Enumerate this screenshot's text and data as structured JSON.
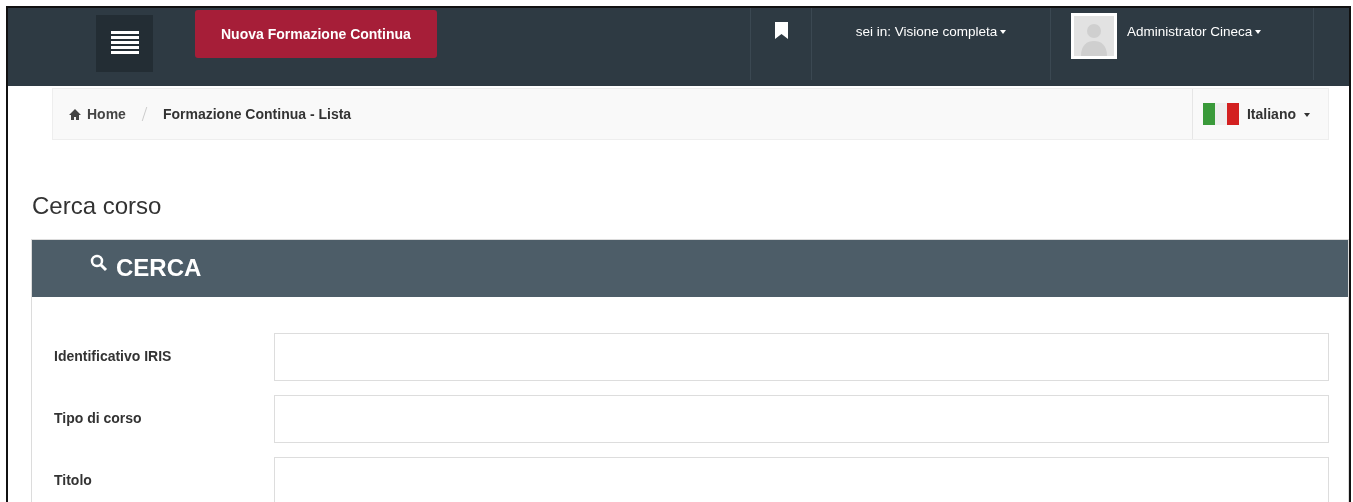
{
  "navbar": {
    "new_button": "Nuova Formazione Continua",
    "context": "sei in: Visione completa",
    "user": "Administrator Cineca"
  },
  "breadcrumb": [
    {
      "label": "Home",
      "selected": false
    },
    {
      "label": "Formazione Continua - Lista",
      "selected": true
    }
  ],
  "language": "Italiano",
  "page_title": "Cerca corso",
  "panel": {
    "title": "CERCA",
    "fields": [
      {
        "label": "Identificativo IRIS"
      },
      {
        "label": "Tipo di corso"
      },
      {
        "label": "Titolo"
      }
    ]
  }
}
